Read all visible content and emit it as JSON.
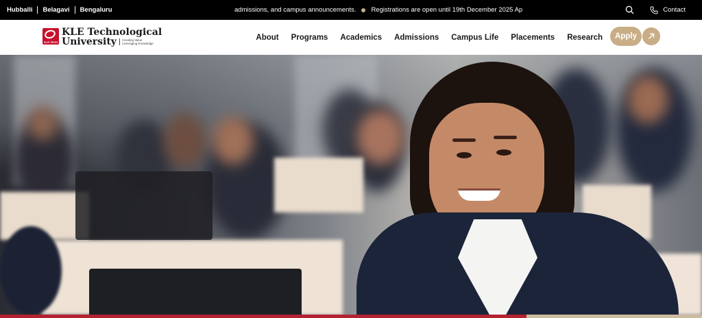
{
  "topbar": {
    "campuses": [
      "Hubballi",
      "Belagavi",
      "Bengaluru"
    ],
    "ticker": [
      "admissions, and campus announcements.",
      "Registrations are open until 19th December 2025 Ap"
    ],
    "contact_label": "Contact"
  },
  "header": {
    "logo": {
      "line1": "KLE Technological",
      "line2": "University",
      "tagline": [
        "Creating Value",
        "Leveraging Knowledge"
      ],
      "mark_text": "KLE TECH"
    },
    "nav": [
      "About",
      "Programs",
      "Academics",
      "Admissions",
      "Campus Life",
      "Placements",
      "Research"
    ],
    "apply_label": "Apply"
  },
  "hero": {
    "slide_progress": 0.75
  },
  "colors": {
    "topbar_bg": "#000000",
    "accent_gold": "#c8ad86",
    "brand_red": "#c8102e"
  }
}
